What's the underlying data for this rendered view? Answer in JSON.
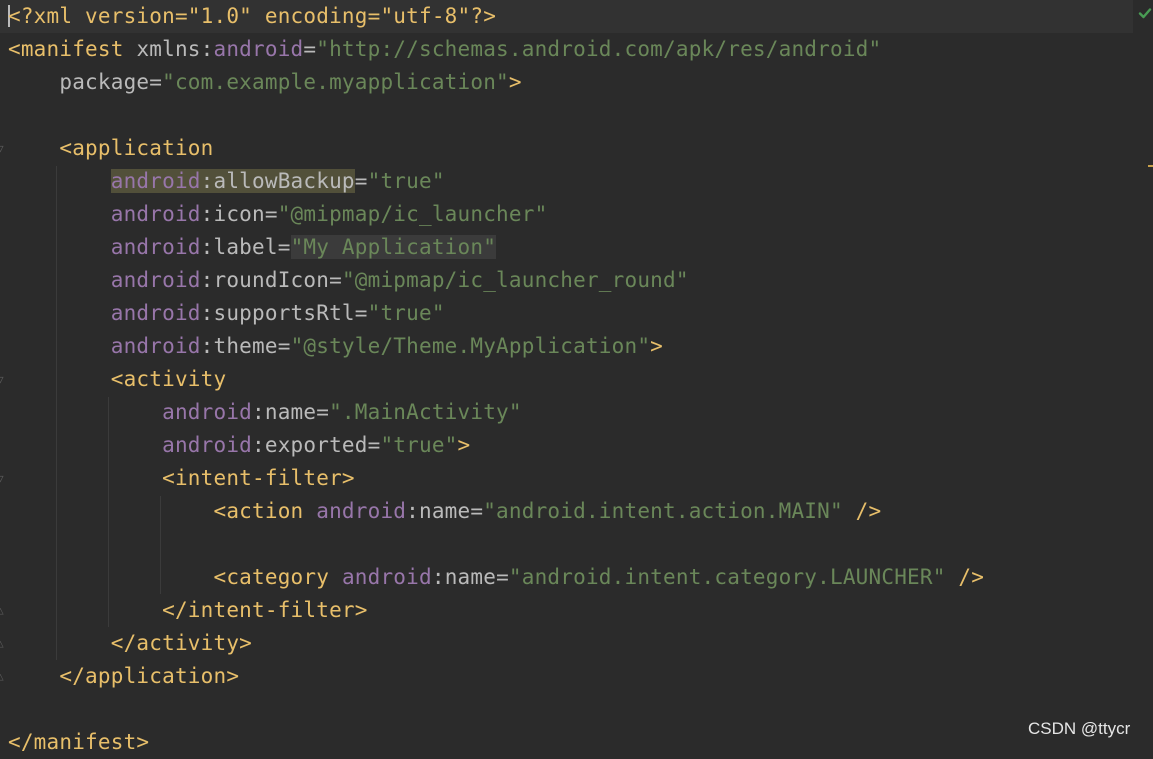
{
  "editor": {
    "lines": {
      "l1": {
        "a": "<?xml version=\"1.0\" encoding=\"utf-8\"?>"
      },
      "l2": {
        "tag": "<manifest",
        "attr": "xmlns:",
        "ns": "android",
        "eq": "=",
        "val": "\"http://schemas.android.com/apk/res/android\""
      },
      "l3": {
        "attr": "package",
        "eq": "=",
        "val": "\"com.example.myapplication\"",
        "close": ">"
      },
      "l5": {
        "tag": "<application"
      },
      "l6": {
        "ns": "android",
        "colon": ":",
        "attr": "allowBackup",
        "eq": "=",
        "val": "\"true\""
      },
      "l7": {
        "ns": "android",
        "colon": ":",
        "attr": "icon",
        "eq": "=",
        "val": "\"@mipmap/ic_launcher\""
      },
      "l8": {
        "ns": "android",
        "colon": ":",
        "attr": "label",
        "eq": "=",
        "val": "\"My Application\""
      },
      "l9": {
        "ns": "android",
        "colon": ":",
        "attr": "roundIcon",
        "eq": "=",
        "val": "\"@mipmap/ic_launcher_round\""
      },
      "l10": {
        "ns": "android",
        "colon": ":",
        "attr": "supportsRtl",
        "eq": "=",
        "val": "\"true\""
      },
      "l11": {
        "ns": "android",
        "colon": ":",
        "attr": "theme",
        "eq": "=",
        "val": "\"@style/Theme.MyApplication\"",
        "close": ">"
      },
      "l12": {
        "tag": "<activity"
      },
      "l13": {
        "ns": "android",
        "colon": ":",
        "attr": "name",
        "eq": "=",
        "val": "\".MainActivity\""
      },
      "l14": {
        "ns": "android",
        "colon": ":",
        "attr": "exported",
        "eq": "=",
        "val": "\"true\"",
        "close": ">"
      },
      "l15": {
        "tag": "<intent-filter>"
      },
      "l16": {
        "tag": "<action",
        "ns": "android",
        "colon": ":",
        "attr": "name",
        "eq": "=",
        "val": "\"android.intent.action.MAIN\"",
        "close": "/>"
      },
      "l18": {
        "tag": "<category",
        "ns": "android",
        "colon": ":",
        "attr": "name",
        "eq": "=",
        "val": "\"android.intent.category.LAUNCHER\"",
        "close": "/>"
      },
      "l19": {
        "tag": "</intent-filter>"
      },
      "l20": {
        "tag": "</activity>"
      },
      "l21": {
        "tag": "</application>"
      },
      "l23": {
        "tag": "</manifest>"
      }
    },
    "status_icon": "check-icon",
    "colors": {
      "background": "#2b2b2b",
      "tag": "#e8bf6a",
      "namespace": "#9876aa",
      "attribute": "#bababa",
      "string": "#6a8759",
      "usage_highlight": "#52503a"
    }
  },
  "watermark": "CSDN @ttycr"
}
